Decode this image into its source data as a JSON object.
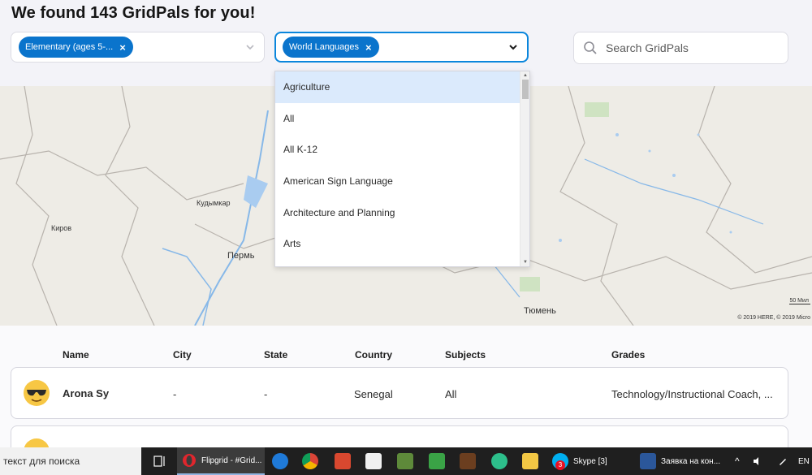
{
  "header": {
    "title": "We found 143 GridPals for you!"
  },
  "filters": {
    "grades": {
      "chip_label": "Elementary (ages 5-...",
      "remove": "×"
    },
    "subjects": {
      "chip_label": "World Languages",
      "remove": "×"
    }
  },
  "search": {
    "placeholder": "Search GridPals"
  },
  "dropdown": {
    "options": [
      "Agriculture",
      "All",
      "All K-12",
      "American Sign Language",
      "Architecture and Planning",
      "Arts"
    ],
    "highlighted": "Agriculture"
  },
  "map": {
    "labels": [
      "Кудымкар",
      "Киров",
      "Пермь",
      "Тюмень"
    ],
    "scale": "50 Мил",
    "copyright": "© 2019 HERE, © 2019 Micro"
  },
  "table": {
    "columns": [
      "Name",
      "City",
      "State",
      "Country",
      "Subjects",
      "Grades"
    ],
    "rows": [
      {
        "name": "Arona Sy",
        "city": "-",
        "state": "-",
        "country": "Senegal",
        "subjects": "All",
        "grades": "Technology/Instructional Coach, ..."
      }
    ]
  },
  "taskbar": {
    "search_text": "текст для поиска",
    "apps": [
      "Flipgrid - #Grid...",
      "Skype [3]",
      "Заявка на кон..."
    ],
    "skype_badge": "3",
    "lang": "EN"
  }
}
